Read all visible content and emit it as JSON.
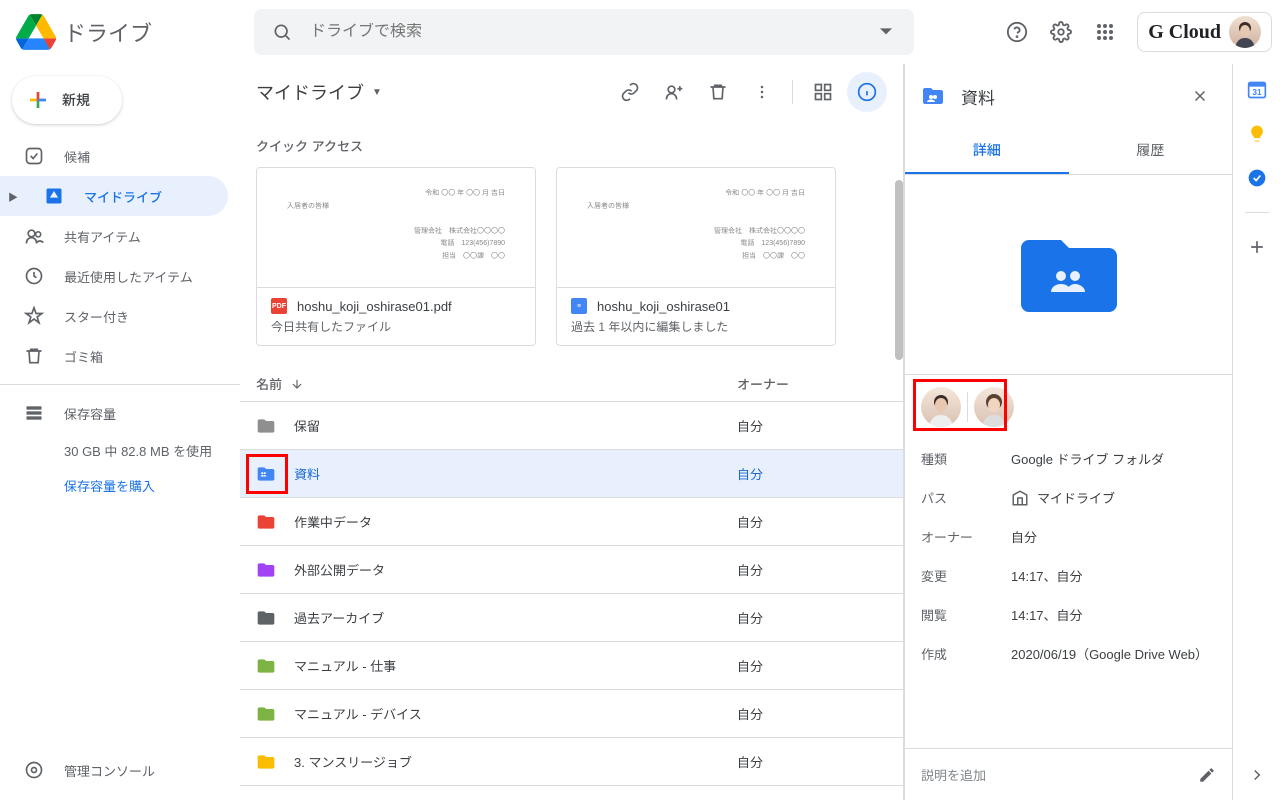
{
  "product_name": "ドライブ",
  "search": {
    "placeholder": "ドライブで検索"
  },
  "brand_label": "G Cloud",
  "new_button": "新規",
  "sidebar": {
    "items": [
      {
        "icon": "checkbox",
        "label": "候補"
      },
      {
        "icon": "drive",
        "label": "マイドライブ",
        "active": true,
        "expandable": true
      },
      {
        "icon": "people",
        "label": "共有アイテム"
      },
      {
        "icon": "clock",
        "label": "最近使用したアイテム"
      },
      {
        "icon": "star",
        "label": "スター付き"
      },
      {
        "icon": "trash",
        "label": "ゴミ箱"
      }
    ],
    "storage_label": "保存容量",
    "storage_usage": "30 GB 中 82.8 MB を使用",
    "storage_link": "保存容量を購入",
    "admin_label": "管理コンソール"
  },
  "breadcrumb": "マイドライブ",
  "quick_access_label": "クイック アクセス",
  "quick_access": [
    {
      "icon": "pdf",
      "name": "hoshu_koji_oshirase01.pdf",
      "sub": "今日共有したファイル"
    },
    {
      "icon": "doc",
      "name": "hoshu_koji_oshirase01",
      "sub": "過去 1 年以内に編集しました"
    }
  ],
  "columns": {
    "name": "名前",
    "owner": "オーナー"
  },
  "files": [
    {
      "color": "#8f8f8f",
      "type": "folder",
      "name": "保留",
      "owner": "自分"
    },
    {
      "color": "#4285f4",
      "type": "shared-folder",
      "name": "資料",
      "owner": "自分",
      "selected": true,
      "highlighted": true
    },
    {
      "color": "#ea4335",
      "type": "folder",
      "name": "作業中データ",
      "owner": "自分"
    },
    {
      "color": "#a142f4",
      "type": "folder",
      "name": "外部公開データ",
      "owner": "自分"
    },
    {
      "color": "#5f6368",
      "type": "folder",
      "name": "過去アーカイブ",
      "owner": "自分"
    },
    {
      "color": "#7cb342",
      "type": "folder",
      "name": "マニュアル - 仕事",
      "owner": "自分"
    },
    {
      "color": "#7cb342",
      "type": "folder",
      "name": "マニュアル - デバイス",
      "owner": "自分"
    },
    {
      "color": "#fbbc04",
      "type": "folder",
      "name": "3. マンスリージョブ",
      "owner": "自分"
    }
  ],
  "details": {
    "title": "資料",
    "tabs": {
      "detail": "詳細",
      "activity": "履歴"
    },
    "keys": {
      "type": "種類",
      "path": "パス",
      "owner": "オーナー",
      "modified": "変更",
      "viewed": "閲覧",
      "created": "作成"
    },
    "type_val": "Google ドライブ フォルダ",
    "path_val": "マイドライブ",
    "owner_val": "自分",
    "modified_val": "14:17、自分",
    "viewed_val": "14:17、自分",
    "created_val": "2020/06/19（Google Drive Web）",
    "description_placeholder": "説明を追加"
  }
}
